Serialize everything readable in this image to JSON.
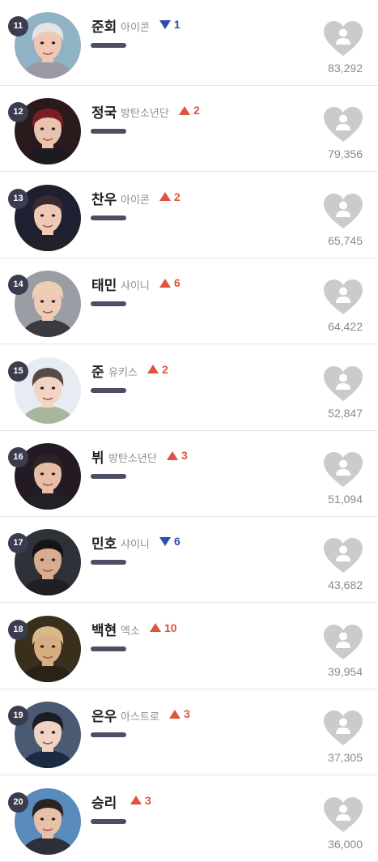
{
  "ranking": [
    {
      "rank": "11",
      "name": "준회",
      "group": "아이콘",
      "direction": "down",
      "change": "1",
      "votes": "83,292",
      "colors": {
        "bg": "#8fb3c4",
        "hair": "#e3e3e6",
        "skin": "#efc7b2",
        "shirt": "#9a9aa6"
      }
    },
    {
      "rank": "12",
      "name": "정국",
      "group": "방탄소년단",
      "direction": "up",
      "change": "2",
      "votes": "79,356",
      "colors": {
        "bg": "#2a1a1c",
        "hair": "#7a1e25",
        "skin": "#e9c3ad",
        "shirt": "#1b1b20"
      }
    },
    {
      "rank": "13",
      "name": "찬우",
      "group": "아이콘",
      "direction": "up",
      "change": "2",
      "votes": "65,745",
      "colors": {
        "bg": "#1c2030",
        "hair": "#3a2a2e",
        "skin": "#f0c9b6",
        "shirt": "#23202a"
      }
    },
    {
      "rank": "14",
      "name": "태민",
      "group": "샤이니",
      "direction": "up",
      "change": "6",
      "votes": "64,422",
      "colors": {
        "bg": "#9a9da4",
        "hair": "#e9d2b3",
        "skin": "#efcab6",
        "shirt": "#3a3b40"
      }
    },
    {
      "rank": "15",
      "name": "준",
      "group": "유키스",
      "direction": "up",
      "change": "2",
      "votes": "52,847",
      "colors": {
        "bg": "#e6ecf2",
        "hair": "#5a4a46",
        "skin": "#f3d4c4",
        "shirt": "#a9b69a"
      }
    },
    {
      "rank": "16",
      "name": "뷔",
      "group": "방탄소년단",
      "direction": "up",
      "change": "3",
      "votes": "51,094",
      "colors": {
        "bg": "#241a24",
        "hair": "#2c2326",
        "skin": "#e6bda5",
        "shirt": "#202026"
      }
    },
    {
      "rank": "17",
      "name": "민호",
      "group": "샤이니",
      "direction": "down",
      "change": "6",
      "votes": "43,682",
      "colors": {
        "bg": "#2f3138",
        "hair": "#141416",
        "skin": "#d9ab8f",
        "shirt": "#1f2025"
      }
    },
    {
      "rank": "18",
      "name": "백현",
      "group": "엑소",
      "direction": "up",
      "change": "10",
      "votes": "39,954",
      "colors": {
        "bg": "#3a2e1d",
        "hair": "#d7b98a",
        "skin": "#d9ad82",
        "shirt": "#2b2217"
      }
    },
    {
      "rank": "19",
      "name": "은우",
      "group": "아스트로",
      "direction": "up",
      "change": "3",
      "votes": "37,305",
      "colors": {
        "bg": "#4b5a73",
        "hair": "#1b1c24",
        "skin": "#efd3c3",
        "shirt": "#1c2a45"
      }
    },
    {
      "rank": "20",
      "name": "승리",
      "group": "",
      "direction": "up",
      "change": "3",
      "votes": "36,000",
      "colors": {
        "bg": "#5a8bbd",
        "hair": "#2a2522",
        "skin": "#e8c0a5",
        "shirt": "#2d2f3a"
      }
    }
  ]
}
